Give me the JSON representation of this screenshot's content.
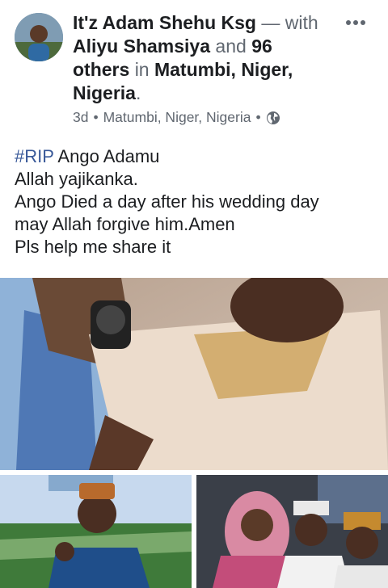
{
  "post": {
    "author": "It'z Adam Shehu Ksg",
    "with_word": "— with",
    "tagged": "Aliyu Shamsiya",
    "and_word": "and",
    "others": "96 others",
    "in_word": "in",
    "location_bold": "Matumbi, Niger, Nigeria",
    "period": ".",
    "time": "3d",
    "separator": "•",
    "location": "Matumbi, Niger, Nigeria",
    "privacy_icon": "globe-icon",
    "more_icon": "more-horizontal-icon"
  },
  "body": {
    "hashtag": "#RIP",
    "lines": [
      "Ango Adamu",
      "Allah yajikanka.",
      "Ango Died a day after his wedding day",
      "may Allah forgive him.Amen",
      "Pls help me share it"
    ]
  },
  "colors": {
    "link": "#385898",
    "text": "#1c1e21",
    "meta": "#606770"
  }
}
